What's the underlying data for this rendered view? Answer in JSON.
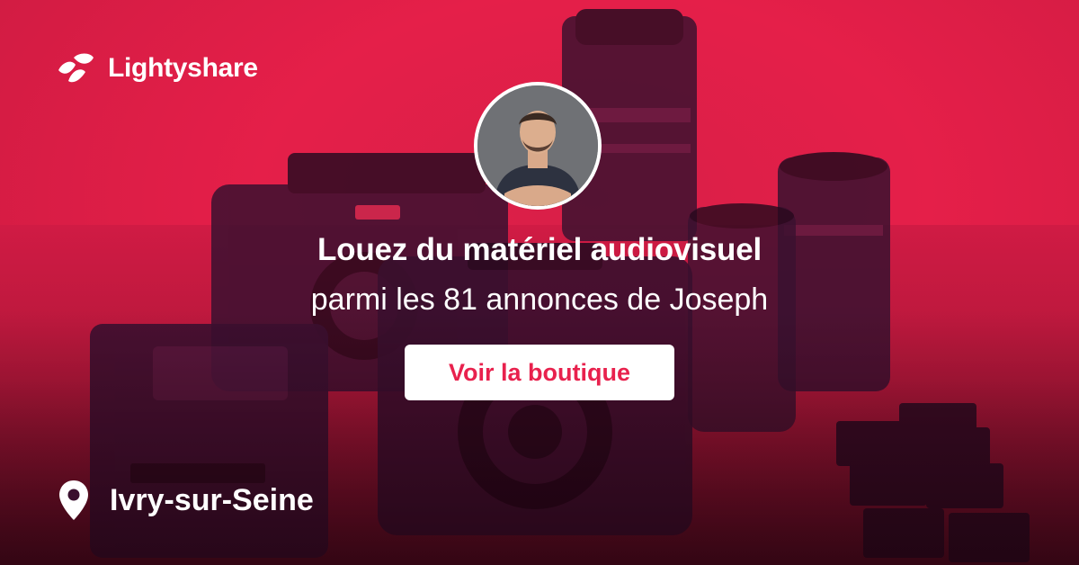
{
  "brand": {
    "name": "Lightyshare",
    "logo_icon": "lightyshare-logo-icon",
    "color": "#e8214d"
  },
  "profile": {
    "avatar": "avatar"
  },
  "hero": {
    "headline": "Louez du matériel audiovisuel",
    "subline": "parmi les 81 annonces de Joseph"
  },
  "cta": {
    "label": "Voir la boutique"
  },
  "location": {
    "icon": "map-pin-icon",
    "city": "Ivry-sur-Seine"
  }
}
